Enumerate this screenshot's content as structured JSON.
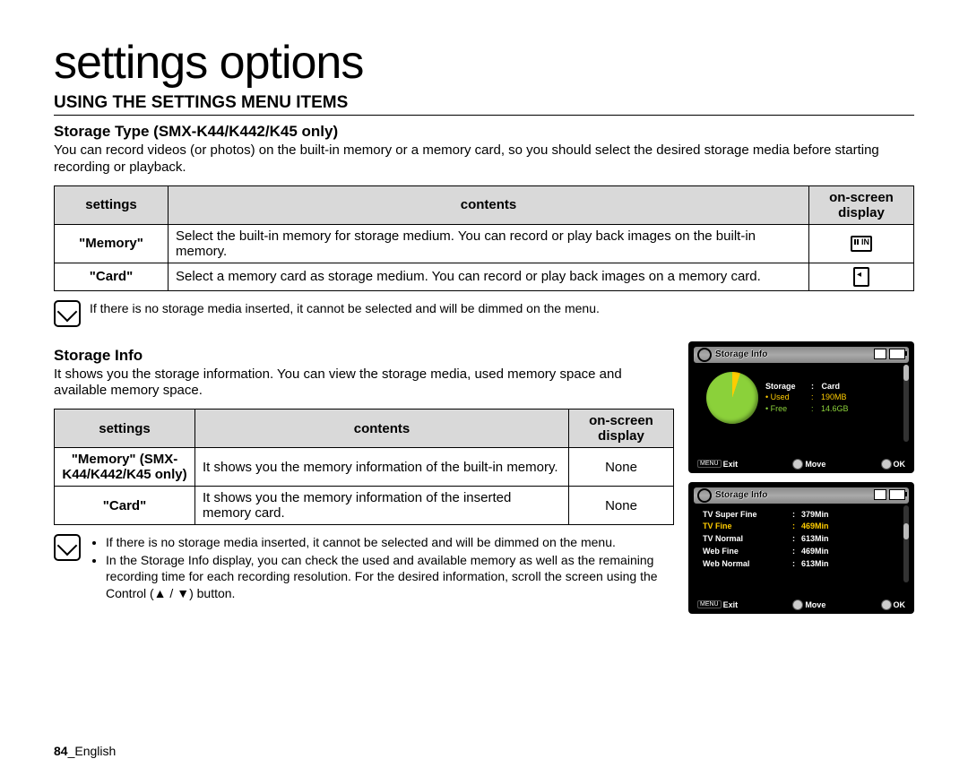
{
  "title": "settings options",
  "section_heading": "USING THE SETTINGS MENU ITEMS",
  "storage_type": {
    "heading": "Storage Type (SMX-K44/K442/K45 only)",
    "intro": "You can record videos (or photos) on the built-in memory or a memory card, so you should select the desired storage media before starting recording or playback.",
    "headers": {
      "settings": "settings",
      "contents": "contents",
      "osd": "on-screen display"
    },
    "rows": [
      {
        "setting": "\"Memory\"",
        "contents": "Select the built-in memory for storage medium. You can record or play back images on the built-in memory."
      },
      {
        "setting": "\"Card\"",
        "contents": "Select a memory card as storage medium. You can record or play back images on a memory card."
      }
    ],
    "note": "If there is no storage media inserted, it cannot be selected and will be dimmed on the menu."
  },
  "storage_info": {
    "heading": "Storage Info",
    "intro": "It shows you the storage information. You can view the storage media, used memory space and available memory space.",
    "headers": {
      "settings": "settings",
      "contents": "contents",
      "osd": "on-screen display"
    },
    "rows": [
      {
        "setting": "\"Memory\" (SMX-K44/K442/K45 only)",
        "contents": "It shows you the memory information of the built-in memory.",
        "osd": "None"
      },
      {
        "setting": "\"Card\"",
        "contents": "It shows you the memory information of the inserted memory card.",
        "osd": "None"
      }
    ],
    "notes": [
      "If there is no storage media inserted, it cannot be selected and will be dimmed on the menu.",
      "In the Storage Info display, you can check the used and available memory as well as the remaining recording time for each recording resolution. For the desired information, scroll the screen using the Control (▲ / ▼) button."
    ]
  },
  "screens": {
    "title": "Storage Info",
    "pie": {
      "storage_label": "Storage",
      "storage_value": "Card",
      "used_label": "Used",
      "used_value": "190MB",
      "free_label": "Free",
      "free_value": "14.6GB"
    },
    "list": [
      {
        "name": "TV Super Fine",
        "value": "379Min"
      },
      {
        "name": "TV Fine",
        "value": "469Min",
        "hl": true
      },
      {
        "name": "TV Normal",
        "value": "613Min"
      },
      {
        "name": "Web Fine",
        "value": "469Min"
      },
      {
        "name": "Web Normal",
        "value": "613Min"
      }
    ],
    "footer": {
      "menu": "MENU",
      "exit": "Exit",
      "move": "Move",
      "ok": "OK"
    }
  },
  "page_footer": {
    "num": "84",
    "lang": "English"
  }
}
